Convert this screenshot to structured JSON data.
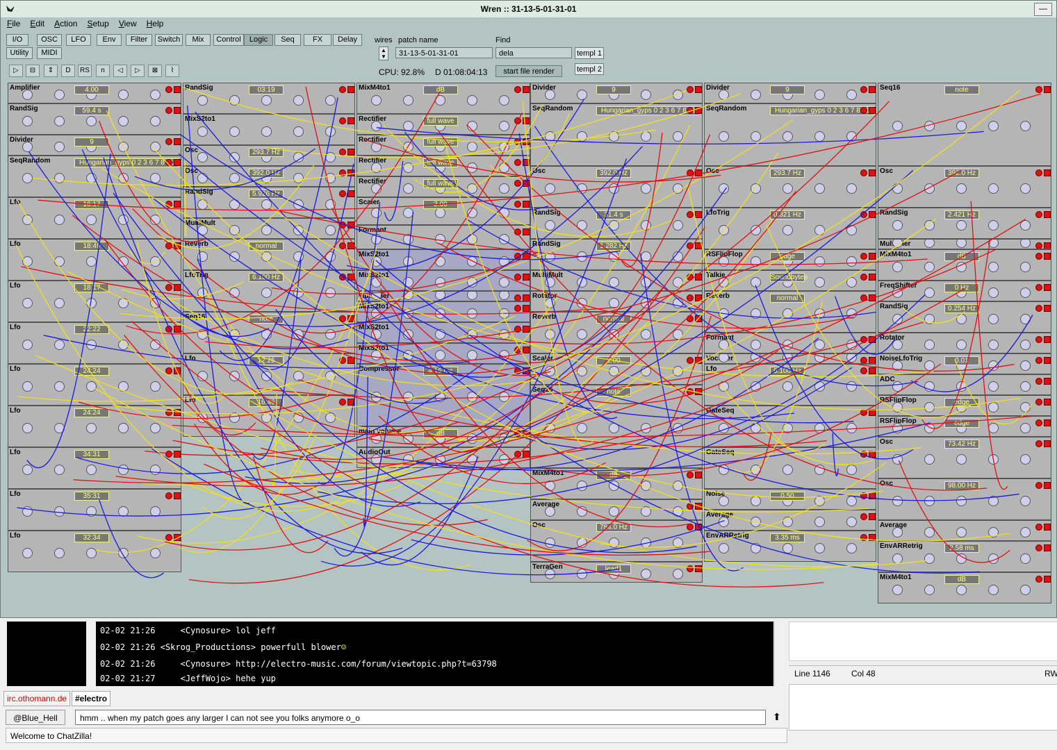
{
  "window": {
    "title": "Wren :: 31-13-5-01-31-01",
    "minimize": "—"
  },
  "menu": [
    {
      "label": "File",
      "u": "F",
      "rest": "ile"
    },
    {
      "label": "Edit",
      "u": "E",
      "rest": "dit"
    },
    {
      "label": "Action",
      "u": "A",
      "rest": "ction"
    },
    {
      "label": "Setup",
      "u": "S",
      "rest": "etup"
    },
    {
      "label": "View",
      "u": "V",
      "rest": "iew"
    },
    {
      "label": "Help",
      "u": "H",
      "rest": "elp"
    }
  ],
  "module_tabs": [
    "I/O",
    "OSC",
    "LFO",
    "Env",
    "Filter",
    "Switch",
    "Mix",
    "Control",
    "Logic",
    "Seq",
    "FX",
    "Delay",
    "Utility",
    "MIDI"
  ],
  "active_tab": "Logic",
  "toolbar": {
    "wires_label": "wires",
    "patch_name_label": "patch name",
    "patch_name": "31-13-5-01-31-01",
    "find_label": "Find",
    "find_value": "dela",
    "templ1": "templ 1",
    "templ2": "templ 2",
    "cpu": "CPU: 92.8%",
    "time": "D 01:08:04:13",
    "render_button": "start file render"
  },
  "modules": {
    "col1": [
      "Amplifier",
      "RandSig",
      "Divider",
      "SeqRandom",
      "Lfo",
      "Lfo",
      "Lfo",
      "Lfo",
      "Lfo",
      "Lfo",
      "Lfo",
      "Lfo",
      "Lfo"
    ],
    "col1_values": [
      "4.00",
      "59.4 s",
      "9",
      "Hungarian_gyps 0 2 3 6 7 8 11",
      "16:17",
      "18:49",
      "18:17",
      "22:22",
      "24:24",
      "24:24",
      "34:31",
      "35:31",
      "32:34"
    ],
    "col2": [
      "RandSig",
      "MixS2to1",
      "Osc",
      "Osc",
      "RandSig",
      "MultiMult",
      "Reverb",
      "LfoTrig",
      "Seq16",
      "Lfo",
      "Lfo"
    ],
    "col2_values": [
      "03:19",
      "",
      "293.7 Hz",
      "392.0 Hz",
      "5.926 Hz",
      "",
      "normal",
      "6.100 Hz",
      "note",
      "12:25",
      "16:46"
    ],
    "col3": [
      "MixM4to1",
      "Rectifier",
      "Rectifier",
      "Rectifier",
      "Rectifier",
      "Scaler",
      "Formant",
      "MixS2to1",
      "MixS2to1",
      "Multiplier",
      "MixS2to1",
      "MixS2to1",
      "MixS2to1",
      "Compressor",
      "main volume",
      "AudioOut"
    ],
    "col3_values": [
      "dB",
      "full wave",
      "full wave",
      "full wave",
      "full wave",
      "2.00",
      "",
      "",
      "",
      "",
      "",
      "",
      "",
      "4.16 ms",
      "dB",
      ""
    ],
    "col4": [
      "Divider",
      "SeqRandom",
      "Osc",
      "RandSig",
      "RandSig",
      "MultiMult",
      "Rotator",
      "Reverb",
      "Scaler",
      "Seq16",
      "MixM4to1",
      "Average",
      "Osc",
      "TerraGen"
    ],
    "col4_values": [
      "9",
      "Hungarian_gyps 0 2 3 6 7 8 11",
      "392.0 Hz",
      "31.4 s",
      "1.282 Hz",
      "",
      "",
      "normal",
      "2.00",
      "note",
      "dB",
      "",
      "784.0 Hz",
      "lead1"
    ],
    "col5": [
      "Divider",
      "SeqRandom",
      "Osc",
      "LfoTrig",
      "RSFlipFlop",
      "Talkie",
      "Reverb",
      "Formant",
      "Vocoder",
      "Lfo",
      "GateSeq",
      "GateSeq",
      "Noise",
      "Average",
      "EnvARRetrig"
    ],
    "col5_values": [
      "9",
      "Hungarian_gyps 0 2 3 6 7 8 11",
      "293.7 Hz",
      "0.321 Hz",
      "edge",
      "Soundbytes",
      "normal",
      "",
      "",
      "6.100 Hz",
      "",
      "",
      "0.50",
      "",
      "3.35 ms"
    ],
    "col6": [
      "Seq16",
      "Osc",
      "RandSig",
      "Multiplier",
      "MixM4to1",
      "FreqShifter",
      "RandSig",
      "Rotator",
      "NoiseLfoTrig",
      "ADC",
      "RSFlipFlop",
      "RSFlipFlop",
      "Osc",
      "Osc",
      "Average",
      "EnvARRetrig",
      "MixM4to1"
    ],
    "col6_values": [
      "note",
      "392.0 Hz",
      "2.421 Hz",
      "",
      "dB",
      "0 Hz",
      "0.254 Hz",
      "",
      "0.01",
      "",
      "edge",
      "edge",
      "73.42 Hz",
      "98.00 Hz",
      "",
      "2.58 ms",
      "dB"
    ]
  },
  "chat": {
    "lines": [
      {
        "time": "02-02 21:26",
        "nick": "Cynosure",
        "text": "lol jeff"
      },
      {
        "time": "02-02 21:26",
        "nick": "Skrog_Productions",
        "text": "powerfull blower"
      },
      {
        "time": "02-02 21:26",
        "nick": "Cynosure",
        "text": "http://electro-music.com/forum/viewtopic.php?t=63798"
      },
      {
        "time": "02-02 21:27",
        "nick": "JeffWojo",
        "text": "hehe yup"
      }
    ],
    "tabs": [
      "irc.othomann.de",
      "#electro"
    ],
    "nick_button": "@Blue_Hell",
    "input": "hmm .. when my patch goes any larger I can not see you folks anymore o_o",
    "welcome": "Welcome to ChatZilla!",
    "status_line": "Line 1146",
    "status_col": "Col 48",
    "status_rw": "RW"
  },
  "colors": {
    "rack_bg": "#b4c4c2",
    "module": "#b5b5b5",
    "wire_red": "#e01010",
    "wire_blue": "#1a1ae0",
    "wire_yellow": "#f0e020"
  }
}
